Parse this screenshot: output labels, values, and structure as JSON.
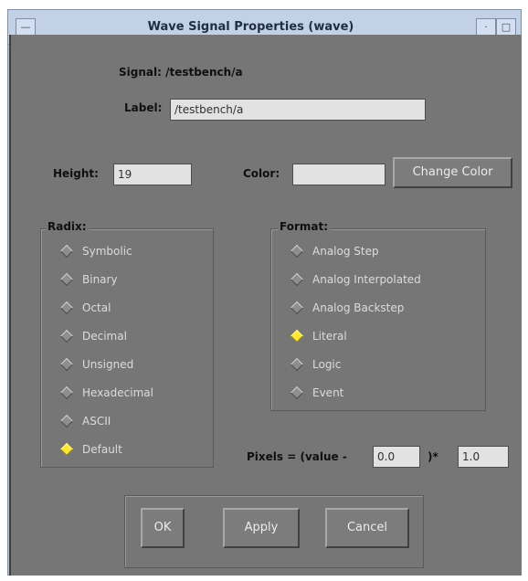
{
  "window": {
    "title": "Wave Signal Properties (wave)",
    "menu_glyph": "—",
    "minimize_glyph": "·",
    "maximize_glyph": "□"
  },
  "signal": {
    "label": "Signal: /testbench/a"
  },
  "label_field": {
    "label": "Label:",
    "value": "/testbench/a"
  },
  "height_field": {
    "label": "Height:",
    "value": "19"
  },
  "color_field": {
    "label": "Color:",
    "value": "",
    "button": "Change Color"
  },
  "radix": {
    "title": "Radix:",
    "selected": "Default",
    "options": [
      "Symbolic",
      "Binary",
      "Octal",
      "Decimal",
      "Unsigned",
      "Hexadecimal",
      "ASCII",
      "Default"
    ]
  },
  "format": {
    "title": "Format:",
    "selected": "Literal",
    "options": [
      "Analog Step",
      "Analog Interpolated",
      "Analog Backstep",
      "Literal",
      "Logic",
      "Event"
    ]
  },
  "pixels": {
    "label_prefix": "Pixels = (value -",
    "offset": "0.0",
    "label_mid": ")*",
    "scale": "1.0"
  },
  "buttons": {
    "ok": "OK",
    "apply": "Apply",
    "cancel": "Cancel"
  }
}
